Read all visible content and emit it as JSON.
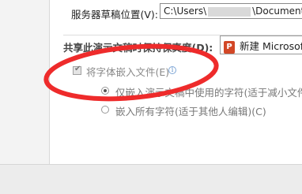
{
  "server_drafts": {
    "label": "服务器草稿位置(V):",
    "path_prefix": "C:\\Users\\",
    "path_suffix": "\\Documents"
  },
  "fidelity": {
    "section_label": "共享此演示文稿时保持保真度(D):",
    "doc_icon": "word-doc-icon",
    "doc_name": "新建 Microsoft"
  },
  "embed_fonts": {
    "checkbox_label": "将字体嵌入文件(E)",
    "checked": true,
    "enabled": false,
    "info_icon": "info-icon",
    "option1_label": "仅嵌入演示文稿中使用的字符(适于减小文件大",
    "option2_label": "嵌入所有字符(适于其他人编辑)(C)",
    "selected_option": 1
  },
  "colors": {
    "annotation": "#ee2b2b",
    "word_icon": "#d24726"
  }
}
